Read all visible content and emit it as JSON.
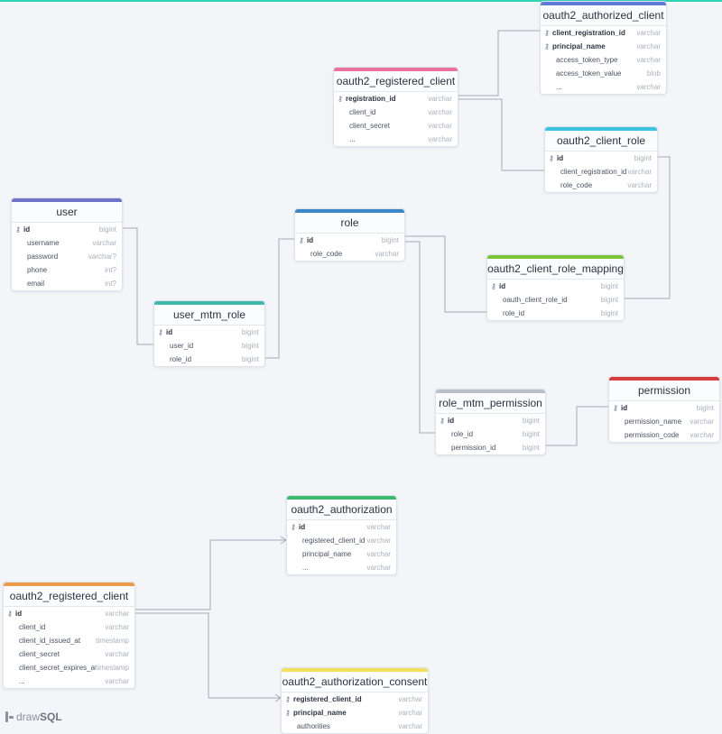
{
  "brand": {
    "name_a": "draw",
    "name_b": "SQL"
  },
  "tables": [
    {
      "id": "oauth2_authorized_client",
      "name": "oauth2_authorized_client",
      "color": "#5b7bd5",
      "columns": [
        {
          "name": "client_registration_id",
          "type": "varchar",
          "key": true
        },
        {
          "name": "principal_name",
          "type": "varchar",
          "key": true
        },
        {
          "name": "access_token_type",
          "type": "varchar",
          "key": false
        },
        {
          "name": "access_token_value",
          "type": "blob",
          "key": false
        },
        {
          "name": "...",
          "type": "varchar",
          "key": false
        }
      ]
    },
    {
      "id": "oauth2_registered_client_a",
      "name": "oauth2_registered_client",
      "color": "#e8739b",
      "columns": [
        {
          "name": "registration_id",
          "type": "varchar",
          "key": true
        },
        {
          "name": "client_id",
          "type": "varchar",
          "key": false
        },
        {
          "name": "client_secret",
          "type": "varchar",
          "key": false
        },
        {
          "name": "...",
          "type": "varchar",
          "key": false
        }
      ]
    },
    {
      "id": "oauth2_client_role",
      "name": "oauth2_client_role",
      "color": "#3ac3e0",
      "columns": [
        {
          "name": "id",
          "type": "bigint",
          "key": true
        },
        {
          "name": "client_registration_id",
          "type": "varchar",
          "key": false
        },
        {
          "name": "role_code",
          "type": "varchar",
          "key": false
        }
      ]
    },
    {
      "id": "user",
      "name": "user",
      "color": "#6f72c9",
      "columns": [
        {
          "name": "id",
          "type": "bigint",
          "key": true
        },
        {
          "name": "username",
          "type": "varchar",
          "key": false
        },
        {
          "name": "password",
          "type": "varchar?",
          "key": false
        },
        {
          "name": "phone",
          "type": "int?",
          "key": false
        },
        {
          "name": "email",
          "type": "int?",
          "key": false
        }
      ]
    },
    {
      "id": "role",
      "name": "role",
      "color": "#3a87c8",
      "columns": [
        {
          "name": "id",
          "type": "bigint",
          "key": true
        },
        {
          "name": "role_code",
          "type": "varchar",
          "key": false
        }
      ]
    },
    {
      "id": "oauth2_client_role_mapping",
      "name": "oauth2_client_role_mapping",
      "color": "#7ac43c",
      "columns": [
        {
          "name": "id",
          "type": "bigint",
          "key": true
        },
        {
          "name": "oauth_client_role_id",
          "type": "bigint",
          "key": false
        },
        {
          "name": "role_id",
          "type": "bigint",
          "key": false
        }
      ]
    },
    {
      "id": "user_mtm_role",
      "name": "user_mtm_role",
      "color": "#43b7a8",
      "columns": [
        {
          "name": "id",
          "type": "bigint",
          "key": true
        },
        {
          "name": "user_id",
          "type": "bigint",
          "key": false
        },
        {
          "name": "role_id",
          "type": "bigint",
          "key": false
        }
      ]
    },
    {
      "id": "role_mtm_permission",
      "name": "role_mtm_permission",
      "color": "#b9bfc8",
      "columns": [
        {
          "name": "id",
          "type": "bigint",
          "key": true
        },
        {
          "name": "role_id",
          "type": "bigint",
          "key": false
        },
        {
          "name": "permission_id",
          "type": "bigint",
          "key": false
        }
      ]
    },
    {
      "id": "permission",
      "name": "permission",
      "color": "#d63d3d",
      "columns": [
        {
          "name": "id",
          "type": "bigint",
          "key": true
        },
        {
          "name": "permission_name",
          "type": "varchar",
          "key": false
        },
        {
          "name": "permission_code",
          "type": "varchar",
          "key": false
        }
      ]
    },
    {
      "id": "oauth2_authorization",
      "name": "oauth2_authorization",
      "color": "#3dba6c",
      "columns": [
        {
          "name": "id",
          "type": "varchar",
          "key": true
        },
        {
          "name": "registered_client_id",
          "type": "varchar",
          "key": false
        },
        {
          "name": "principal_name",
          "type": "varchar",
          "key": false
        },
        {
          "name": "...",
          "type": "varchar",
          "key": false
        }
      ]
    },
    {
      "id": "oauth2_registered_client_b",
      "name": "oauth2_registered_client",
      "color": "#ef9a4a",
      "columns": [
        {
          "name": "id",
          "type": "varchar",
          "key": true
        },
        {
          "name": "client_id",
          "type": "varchar",
          "key": false
        },
        {
          "name": "client_id_issued_at",
          "type": "timestamp",
          "key": false
        },
        {
          "name": "client_secret",
          "type": "varchar",
          "key": false
        },
        {
          "name": "client_secret_expires_at",
          "type": "timestamp",
          "key": false
        },
        {
          "name": "...",
          "type": "varchar",
          "key": false
        }
      ]
    },
    {
      "id": "oauth2_authorization_consent",
      "name": "oauth2_authorization_consent",
      "color": "#f2df5a",
      "columns": [
        {
          "name": "registered_client_id",
          "type": "varchar",
          "key": true
        },
        {
          "name": "principal_name",
          "type": "varchar",
          "key": true
        },
        {
          "name": "authorities",
          "type": "varchar",
          "key": false
        }
      ]
    }
  ]
}
